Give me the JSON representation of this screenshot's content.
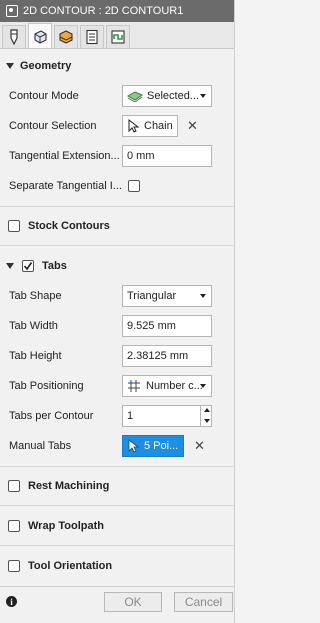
{
  "window": {
    "title": "2D CONTOUR : 2D CONTOUR1"
  },
  "tabs": [
    {
      "name": "tool-tab-icon"
    },
    {
      "name": "geometry-tab-icon"
    },
    {
      "name": "heights-tab-icon"
    },
    {
      "name": "passes-tab-icon"
    },
    {
      "name": "linking-tab-icon"
    }
  ],
  "geometry": {
    "header": "Geometry",
    "contour_mode_label": "Contour Mode",
    "contour_mode_value": "Selected...",
    "contour_selection_label": "Contour Selection",
    "contour_selection_value": "Chain",
    "tangential_extension_label": "Tangential Extension...",
    "tangential_extension_value": "0 mm",
    "separate_tangential_label": "Separate Tangential I..."
  },
  "stock_contours": {
    "label": "Stock Contours"
  },
  "tabs_section": {
    "header": "Tabs",
    "tab_shape_label": "Tab Shape",
    "tab_shape_value": "Triangular",
    "tab_width_label": "Tab Width",
    "tab_width_value": "9.525 mm",
    "tab_height_label": "Tab Height",
    "tab_height_value": "2.38125 mm",
    "tab_positioning_label": "Tab Positioning",
    "tab_positioning_value": "Number c...",
    "tabs_per_contour_label": "Tabs per Contour",
    "tabs_per_contour_value": "1",
    "manual_tabs_label": "Manual Tabs",
    "manual_tabs_value": "5 Poi..."
  },
  "rest_machining": {
    "label": "Rest Machining"
  },
  "wrap_toolpath": {
    "label": "Wrap Toolpath"
  },
  "tool_orientation": {
    "label": "Tool Orientation"
  },
  "footer": {
    "ok_label": "OK",
    "cancel_label": "Cancel"
  },
  "colors": {
    "accent": "#1a8fe3",
    "titlebar": "#6b6b6b"
  }
}
